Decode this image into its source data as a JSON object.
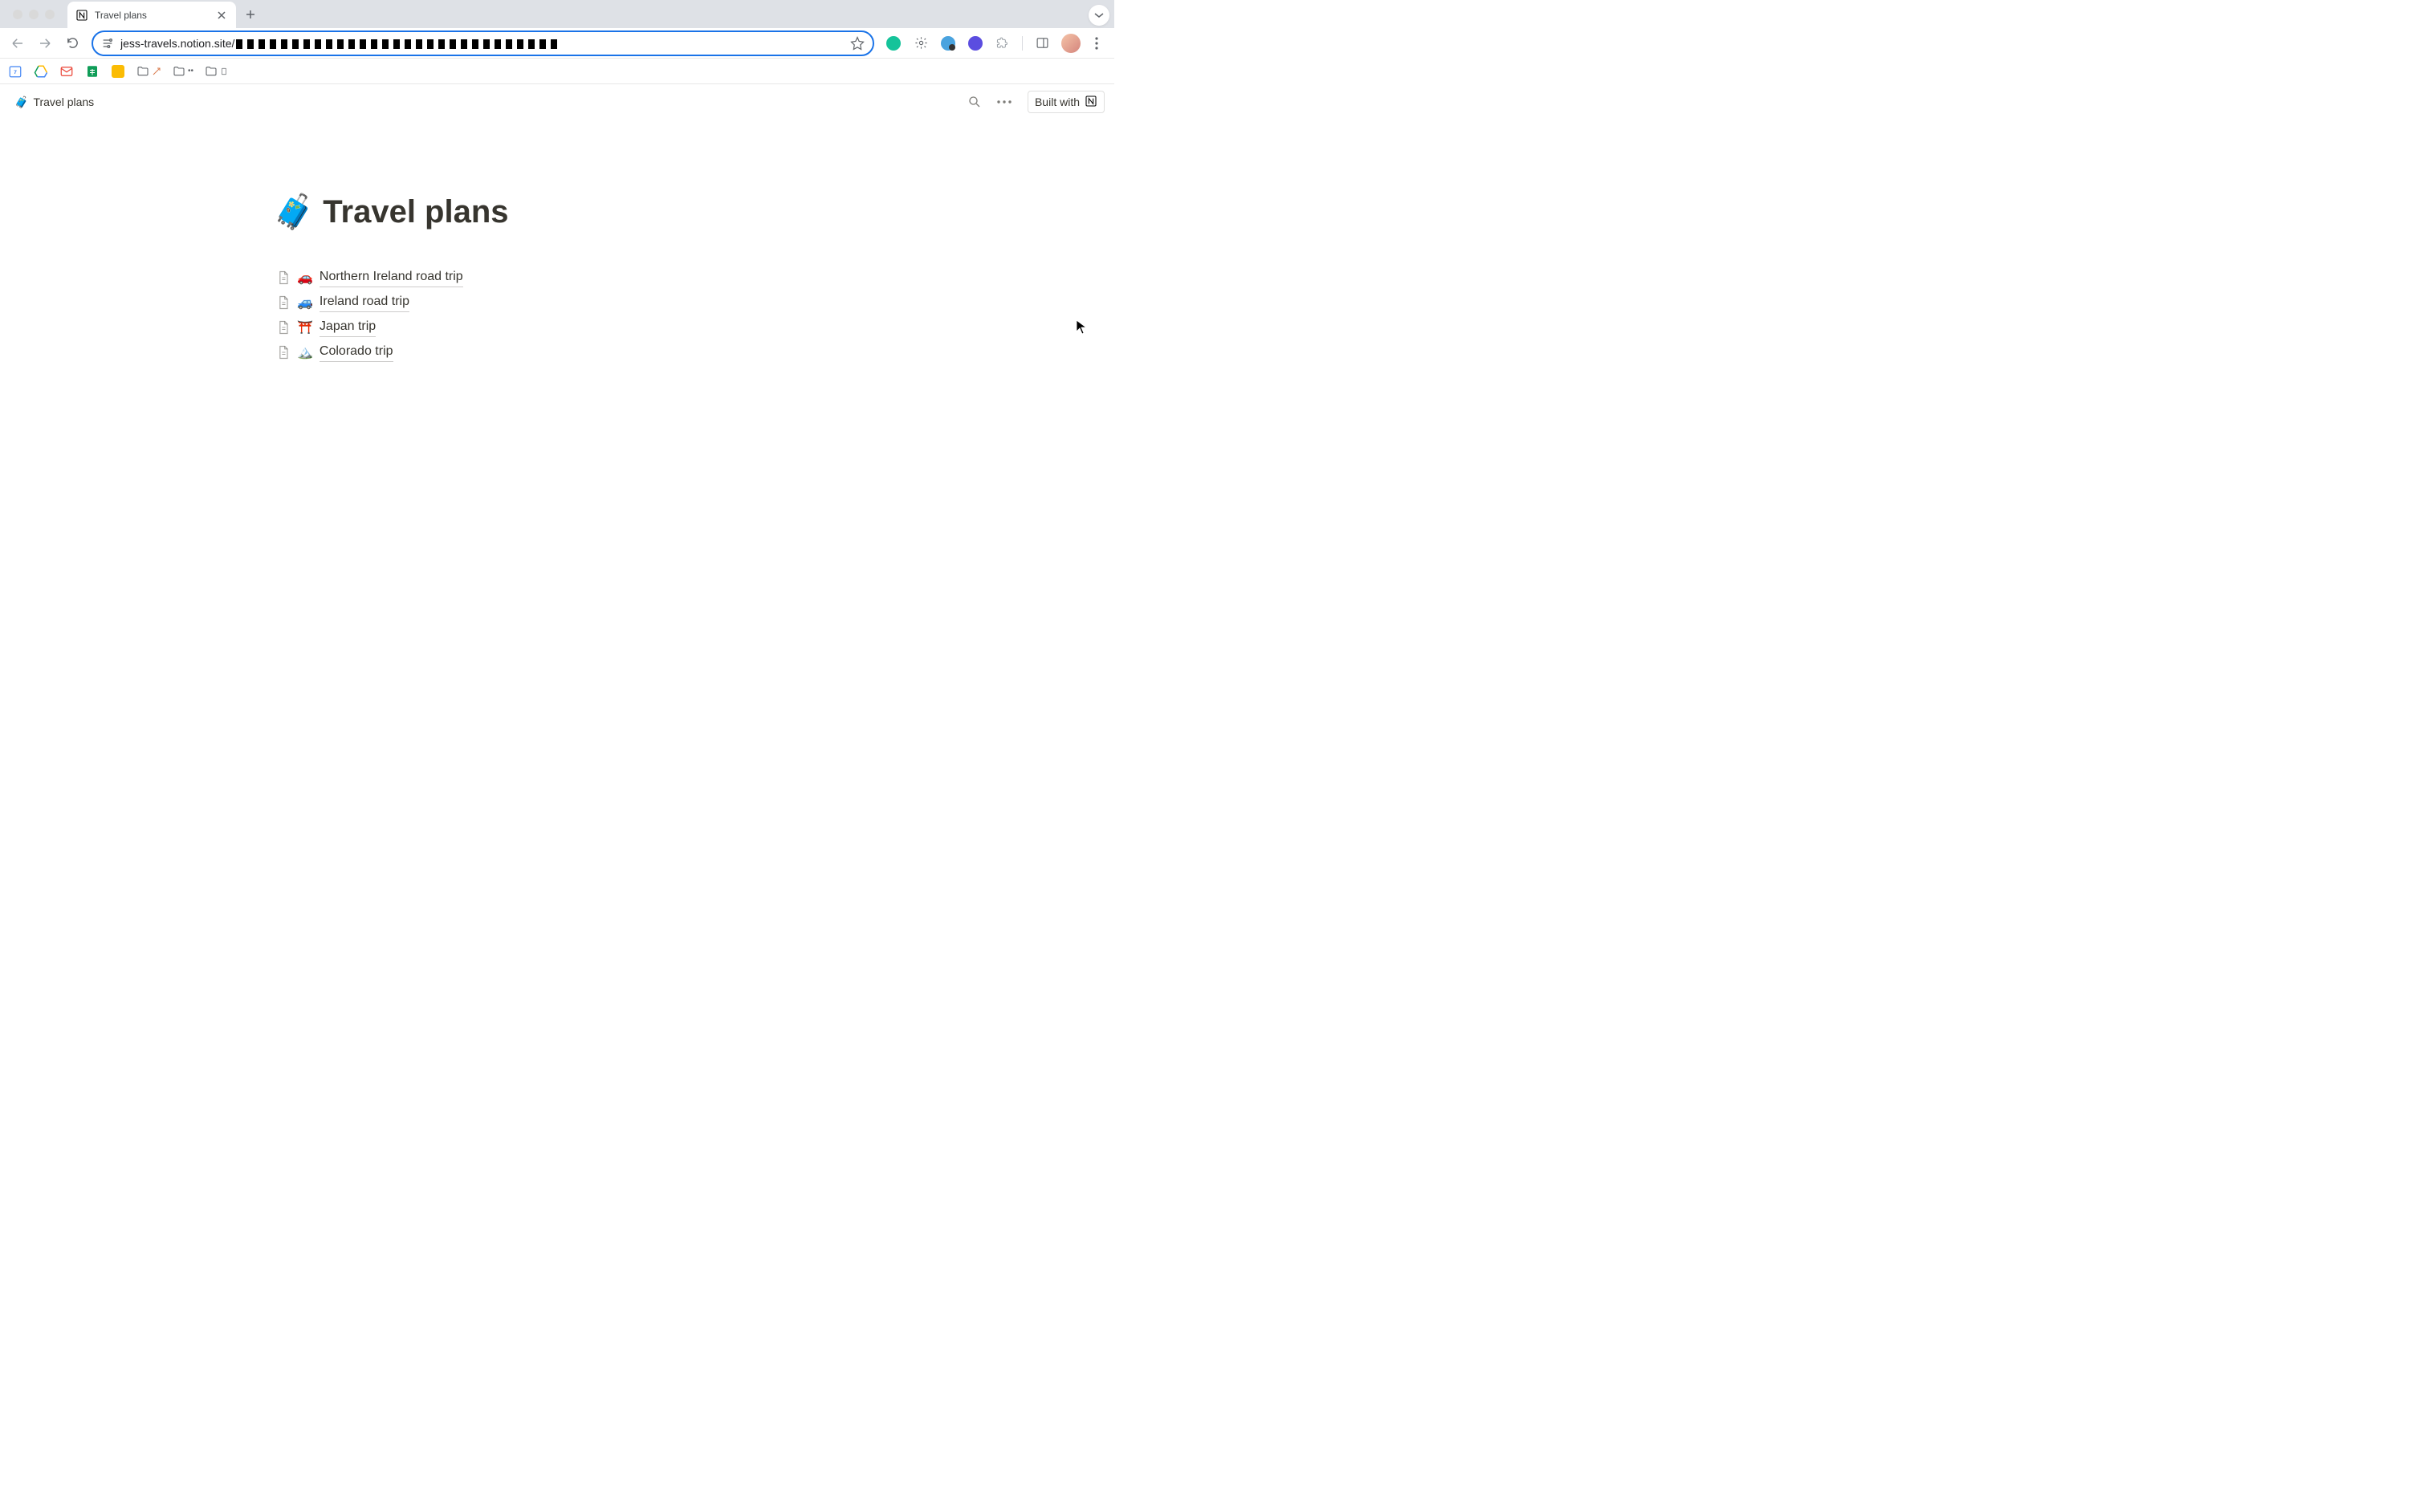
{
  "browser": {
    "tab": {
      "title": "Travel plans"
    },
    "url_domain": "jess-travels.notion.site/"
  },
  "notion": {
    "breadcrumb": {
      "emoji": "🧳",
      "label": "Travel plans"
    },
    "built_with_label": "Built with",
    "page": {
      "emoji": "🧳",
      "title": "Travel plans",
      "links": [
        {
          "emoji": "🚗",
          "label": "Northern Ireland road trip"
        },
        {
          "emoji": "🚙",
          "label": "Ireland road trip"
        },
        {
          "emoji": "⛩️",
          "label": "Japan trip"
        },
        {
          "emoji": "🏔️",
          "label": "Colorado trip"
        }
      ]
    }
  }
}
